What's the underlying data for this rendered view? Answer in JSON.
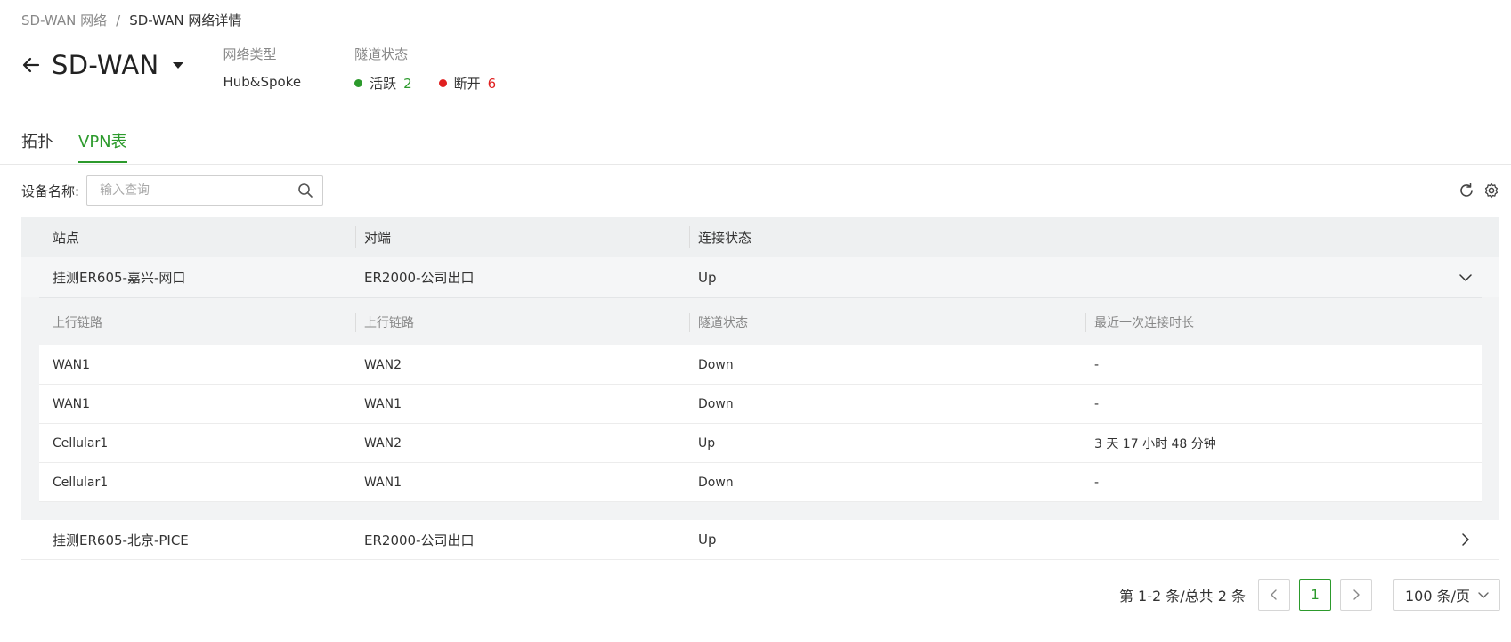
{
  "breadcrumb": {
    "parent": "SD-WAN 网络",
    "separator": "/",
    "current": "SD-WAN 网络详情"
  },
  "header": {
    "title": "SD-WAN",
    "network_type_label": "网络类型",
    "network_type_value": "Hub&Spoke",
    "tunnel_status_label": "隧道状态",
    "active_label": "活跃",
    "active_count": "2",
    "down_label": "断开",
    "down_count": "6"
  },
  "tabs": [
    {
      "label": "拓扑"
    },
    {
      "label": "VPN表"
    }
  ],
  "filter": {
    "label": "设备名称:",
    "placeholder": "输入查询"
  },
  "table": {
    "columns": [
      "站点",
      "对端",
      "连接状态"
    ],
    "rows": [
      {
        "site": "挂测ER605-嘉兴-网口",
        "peer": "ER2000-公司出口",
        "status": "Up",
        "sub_columns": [
          "上行链路",
          "上行链路",
          "隧道状态",
          "最近一次连接时长"
        ],
        "sub_rows": [
          [
            "WAN1",
            "WAN2",
            "Down",
            "-"
          ],
          [
            "WAN1",
            "WAN1",
            "Down",
            "-"
          ],
          [
            "Cellular1",
            "WAN2",
            "Up",
            "3 天 17 小时 48 分钟"
          ],
          [
            "Cellular1",
            "WAN1",
            "Down",
            "-"
          ]
        ]
      },
      {
        "site": "挂测ER605-北京-PICE",
        "peer": "ER2000-公司出口",
        "status": "Up"
      }
    ]
  },
  "pagination": {
    "info": "第 1-2 条/总共 2 条",
    "current_page": "1",
    "page_size": "100 条/页"
  },
  "colors": {
    "accent": "#2c9a2c",
    "danger": "#e02020"
  }
}
